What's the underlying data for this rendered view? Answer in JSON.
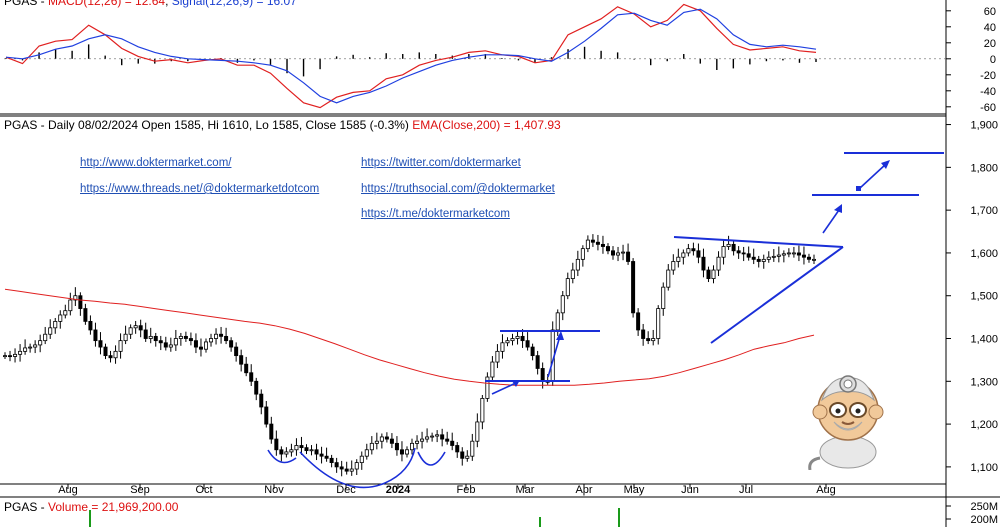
{
  "macd_title": {
    "prefix": "PGAS - ",
    "macd": "MACD(12,26) = 12.64",
    "sep": ", ",
    "signal": "Signal(12,26,9) = 16.07"
  },
  "price_title": {
    "text": "PGAS - Daily 08/02/2024 Open 1585, Hi 1610, Lo 1585, Close 1585 (-0.3%) ",
    "ema": "EMA(Close,200) = 1,407.93"
  },
  "volume_title": {
    "prefix": "PGAS - ",
    "text": "Volume = 21,969,200.00"
  },
  "links": {
    "dm": "http://www.doktermarket.com/",
    "threads": "https://www.threads.net/@doktermarketdotcom",
    "twitter": "https://twitter.com/doktermarket",
    "truth": "https://truthsocial.com/@doktermarket",
    "telegram": "https://t.me/doktermarketcom"
  },
  "colors": {
    "macd": "#e02020",
    "signal": "#2040e0",
    "ema": "#e02020",
    "annotation": "#1a2fd8",
    "hist": "#000000",
    "grid": "#000000"
  },
  "chart_data": [
    {
      "type": "line",
      "name": "MACD panel",
      "y_ticks": [
        60,
        40,
        20,
        0,
        -20,
        -40,
        -60
      ],
      "y_tick_labels": [
        "60",
        "40",
        "20",
        "0",
        "-20",
        "-40",
        "-60"
      ],
      "ylim": [
        -64,
        66
      ],
      "series": [
        {
          "name": "MACD(12,26)",
          "values": [
            2,
            -6,
            16,
            22,
            24,
            42,
            30,
            13,
            3,
            -3,
            -1,
            -5,
            -2,
            0,
            -8,
            -8,
            -18,
            -37,
            -55,
            -61,
            -48,
            -42,
            -40,
            -25,
            -20,
            -8,
            -2,
            2,
            8,
            10,
            5,
            3,
            -5,
            -2,
            30,
            40,
            50,
            65,
            56,
            40,
            48,
            68,
            60,
            38,
            18,
            11,
            13,
            15,
            10,
            8
          ]
        },
        {
          "name": "Signal(12,26,9)",
          "values": [
            2,
            0,
            5,
            12,
            16,
            25,
            30,
            25,
            15,
            8,
            3,
            0,
            -1,
            -2,
            -3,
            -5,
            -8,
            -15,
            -30,
            -47,
            -55,
            -47,
            -42,
            -34,
            -24,
            -16,
            -8,
            -2,
            2,
            5,
            5,
            4,
            0,
            -3,
            8,
            22,
            38,
            55,
            57,
            48,
            42,
            58,
            62,
            50,
            30,
            18,
            15,
            17,
            15,
            12
          ]
        }
      ],
      "histogram": [
        1,
        -2,
        8,
        12,
        10,
        18,
        4,
        -8,
        -6,
        -6,
        -3,
        -3,
        -1,
        1,
        -5,
        -2,
        -8,
        -18,
        -22,
        -13,
        3,
        5,
        2,
        7,
        6,
        8,
        6,
        4,
        6,
        6,
        1,
        -2,
        -5,
        2,
        12,
        15,
        10,
        8,
        -1,
        -8,
        -3,
        6,
        -6,
        -14,
        -12,
        -7,
        -3,
        -2,
        -5,
        -4
      ]
    },
    {
      "type": "candlestick",
      "name": "PGAS - Daily",
      "x": [
        "Aug",
        "Sep",
        "Oct",
        "Nov",
        "Dec",
        "2024",
        "Feb",
        "Mar",
        "Apr",
        "May",
        "Jun",
        "Jul",
        "Aug"
      ],
      "y_ticks": [
        1100,
        1200,
        1300,
        1400,
        1500,
        1600,
        1700,
        1800,
        1900
      ],
      "y_tick_labels": [
        "1,100",
        "1,200",
        "1,300",
        "1,400",
        "1,500",
        "1,600",
        "1,700",
        "1,800",
        "1,900"
      ],
      "ylim": [
        1060,
        1920
      ],
      "close": [
        1360,
        1358,
        1363,
        1370,
        1378,
        1380,
        1385,
        1395,
        1410,
        1425,
        1440,
        1455,
        1465,
        1490,
        1500,
        1470,
        1440,
        1420,
        1395,
        1380,
        1360,
        1355,
        1370,
        1395,
        1410,
        1425,
        1430,
        1420,
        1400,
        1405,
        1395,
        1390,
        1380,
        1385,
        1400,
        1405,
        1400,
        1395,
        1380,
        1375,
        1392,
        1400,
        1410,
        1405,
        1395,
        1380,
        1360,
        1340,
        1320,
        1300,
        1270,
        1240,
        1200,
        1165,
        1140,
        1130,
        1135,
        1140,
        1150,
        1145,
        1138,
        1140,
        1130,
        1125,
        1120,
        1110,
        1100,
        1095,
        1090,
        1095,
        1110,
        1125,
        1140,
        1155,
        1160,
        1170,
        1165,
        1155,
        1140,
        1130,
        1140,
        1155,
        1160,
        1165,
        1170,
        1172,
        1175,
        1165,
        1160,
        1150,
        1135,
        1120,
        1125,
        1160,
        1205,
        1260,
        1310,
        1345,
        1370,
        1390,
        1395,
        1400,
        1405,
        1395,
        1380,
        1360,
        1330,
        1300,
        1300,
        1420,
        1460,
        1500,
        1540,
        1560,
        1585,
        1610,
        1630,
        1625,
        1620,
        1615,
        1605,
        1595,
        1600,
        1602,
        1580,
        1460,
        1420,
        1400,
        1395,
        1400,
        1470,
        1520,
        1560,
        1580,
        1590,
        1600,
        1610,
        1605,
        1590,
        1560,
        1540,
        1560,
        1590,
        1615,
        1620,
        1605,
        1600,
        1598,
        1590,
        1585,
        1580,
        1585,
        1590,
        1592,
        1595,
        1598,
        1600,
        1600,
        1595,
        1590,
        1585,
        1585
      ],
      "ema_200": [
        1515,
        1510,
        1505,
        1500,
        1495,
        1490,
        1487,
        1483,
        1480,
        1475,
        1470,
        1465,
        1460,
        1455,
        1450,
        1445,
        1440,
        1436,
        1430,
        1422,
        1412,
        1400,
        1388,
        1375,
        1362,
        1350,
        1340,
        1330,
        1320,
        1312,
        1305,
        1300,
        1296,
        1293,
        1291,
        1291,
        1291,
        1291,
        1291,
        1293,
        1296,
        1300,
        1303,
        1306,
        1312,
        1320,
        1330,
        1340,
        1350,
        1362,
        1375,
        1383,
        1390,
        1400,
        1408
      ],
      "annotations": [
        {
          "type": "rounded-bottom",
          "label": ""
        },
        {
          "type": "breakout-target",
          "from": 1300,
          "to": 1425
        },
        {
          "type": "triangle",
          "resistance": 1625,
          "support_from": 1395
        },
        {
          "type": "breakout-target",
          "from": 1755,
          "to": 1855
        }
      ]
    },
    {
      "type": "bar",
      "name": "Volume",
      "y_tick_labels": [
        "250M",
        "200M"
      ],
      "values_note": ""
    }
  ],
  "x_axis_labels": [
    "Aug",
    "Sep",
    "Oct",
    "Nov",
    "Dec",
    "2024",
    "Feb",
    "Mar",
    "Apr",
    "May",
    "Jun",
    "Jul",
    "Aug"
  ]
}
